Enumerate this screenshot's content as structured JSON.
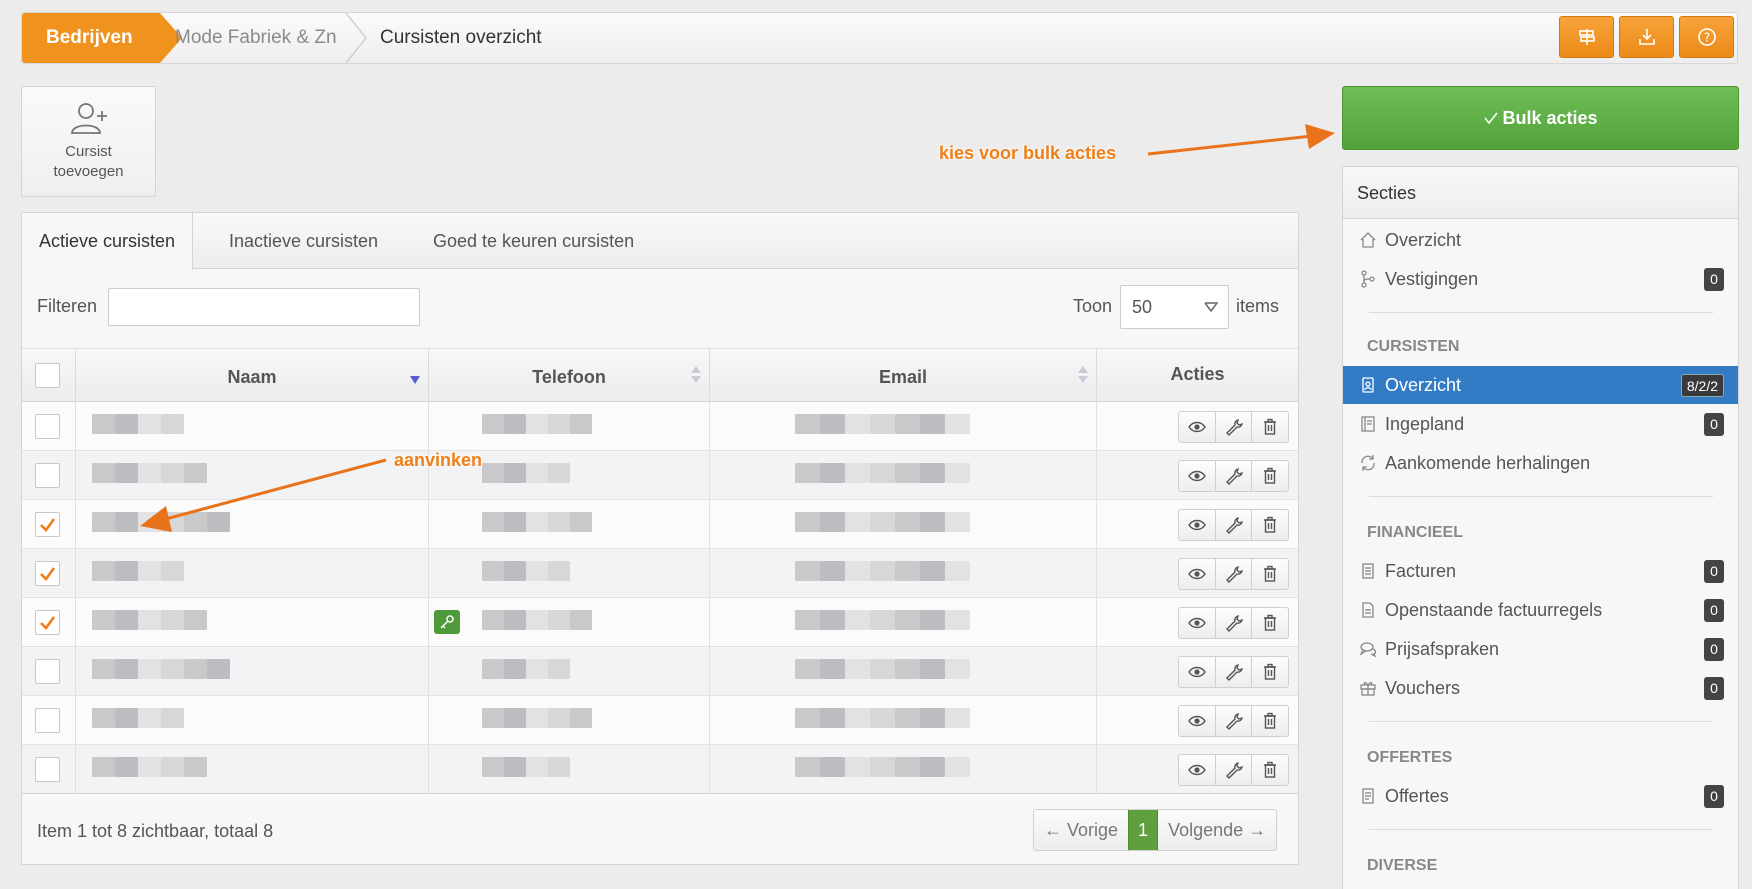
{
  "breadcrumb": {
    "items": [
      "Bedrijven",
      "Mode Fabriek & Zn",
      "Cursisten overzicht"
    ]
  },
  "toolbar": {
    "buttons": [
      "signpost-icon",
      "download-icon",
      "help-icon"
    ]
  },
  "add_card": {
    "label_line1": "Cursist",
    "label_line2": "toevoegen"
  },
  "tabs": [
    "Actieve cursisten",
    "Inactieve cursisten",
    "Goed te keuren cursisten"
  ],
  "filter": {
    "label": "Filteren",
    "value": "",
    "placeholder": ""
  },
  "page_size": {
    "label": "Toon",
    "value": "50",
    "suffix": "items"
  },
  "table": {
    "columns": [
      "Naam",
      "Telefoon",
      "Email",
      "Acties"
    ],
    "rows": [
      {
        "checked": false,
        "has_key": false
      },
      {
        "checked": false,
        "has_key": false
      },
      {
        "checked": true,
        "has_key": false
      },
      {
        "checked": true,
        "has_key": false
      },
      {
        "checked": true,
        "has_key": true
      },
      {
        "checked": false,
        "has_key": false
      },
      {
        "checked": false,
        "has_key": false
      },
      {
        "checked": false,
        "has_key": false
      }
    ]
  },
  "footer": {
    "summary": "Item 1 tot 8 zichtbaar, totaal 8",
    "prev": "← Vorige",
    "current": "1",
    "next": "Volgende →"
  },
  "bulk": {
    "label": "Bulk acties"
  },
  "sections": {
    "title": "Secties",
    "top_items": [
      {
        "label": "Overzicht",
        "icon": "home-icon"
      },
      {
        "label": "Vestigingen",
        "icon": "branch-icon",
        "badge": "0"
      }
    ],
    "cursisten": {
      "title": "CURSISTEN",
      "items": [
        {
          "label": "Overzicht",
          "icon": "id-badge-icon",
          "badge": "8/2/2",
          "active": true
        },
        {
          "label": "Ingepland",
          "icon": "book-icon",
          "badge": "0"
        },
        {
          "label": "Aankomende herhalingen",
          "icon": "refresh-icon"
        }
      ]
    },
    "financieel": {
      "title": "FINANCIEEL",
      "items": [
        {
          "label": "Facturen",
          "icon": "invoice-icon",
          "badge": "0"
        },
        {
          "label": "Openstaande factuurregels",
          "icon": "file-icon",
          "badge": "0"
        },
        {
          "label": "Prijsafspraken",
          "icon": "chat-icon",
          "badge": "0"
        },
        {
          "label": "Vouchers",
          "icon": "gift-icon",
          "badge": "0"
        }
      ]
    },
    "offertes": {
      "title": "OFFERTES",
      "items": [
        {
          "label": "Offertes",
          "icon": "document-icon",
          "badge": "0"
        }
      ]
    },
    "diverse": {
      "title": "DIVERSE"
    }
  },
  "annotations": {
    "bulk_hint": "kies voor bulk acties",
    "check_hint": "aanvinken"
  },
  "colors": {
    "accent_orange": "#f0921e",
    "active_blue": "#347bc6",
    "success_green": "#5f9f3e",
    "annotation": "#f07f17"
  }
}
